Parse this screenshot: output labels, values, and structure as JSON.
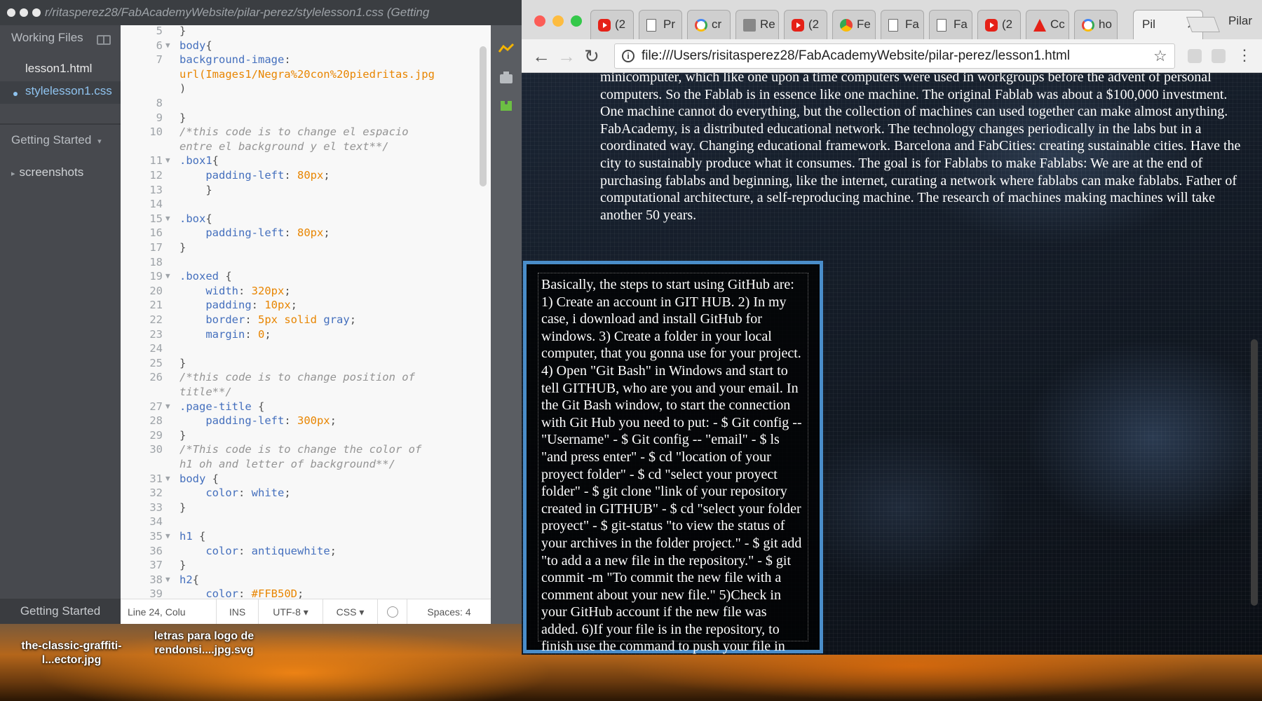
{
  "editor": {
    "title": "r/ritasperez28/FabAcademyWebsite/pilar-perez/stylelesson1.css (Getting",
    "sidebar": {
      "working_files_label": "Working Files",
      "files": [
        "lesson1.html",
        "stylelesson1.css"
      ],
      "project_label": "Getting Started",
      "project_folder": "screenshots",
      "bottom_tab": "Getting Started"
    },
    "code_lines": [
      {
        "n": "5",
        "fold": "",
        "html": "<span class='s-pun'>}</span>"
      },
      {
        "n": "6",
        "fold": "▼",
        "html": "<span class='s-sel'>body</span><span class='s-pun'>{</span>"
      },
      {
        "n": "7",
        "fold": "",
        "html": "<span class='s-prop'>background-image</span><span class='s-pun'>:</span>"
      },
      {
        "n": "",
        "fold": "",
        "html": "<span class='s-val'>url(Images1/Negra%20con%20piedritas.jpg</span>"
      },
      {
        "n": "",
        "fold": "",
        "html": "<span class='s-pun'>)</span>"
      },
      {
        "n": "8",
        "fold": "",
        "html": ""
      },
      {
        "n": "9",
        "fold": "",
        "html": "<span class='s-pun'>}</span>"
      },
      {
        "n": "10",
        "fold": "",
        "html": "<span class='s-com'>/*this code is to change el espacio</span>"
      },
      {
        "n": "",
        "fold": "",
        "html": "<span class='s-com'>entre el background y el text**/</span>"
      },
      {
        "n": "11",
        "fold": "▼",
        "html": "<span class='s-sel'>.box1</span><span class='s-pun'>{</span>"
      },
      {
        "n": "12",
        "fold": "",
        "html": "    <span class='s-prop'>padding-left</span><span class='s-pun'>: </span><span class='s-num'>80px</span><span class='s-pun'>;</span>"
      },
      {
        "n": "13",
        "fold": "",
        "html": "    <span class='s-pun'>}</span>"
      },
      {
        "n": "14",
        "fold": "",
        "html": ""
      },
      {
        "n": "15",
        "fold": "▼",
        "html": "<span class='s-sel'>.box</span><span class='s-pun'>{</span>"
      },
      {
        "n": "16",
        "fold": "",
        "html": "    <span class='s-prop'>padding-left</span><span class='s-pun'>: </span><span class='s-num'>80px</span><span class='s-pun'>;</span>"
      },
      {
        "n": "17",
        "fold": "",
        "html": "<span class='s-pun'>}</span>"
      },
      {
        "n": "18",
        "fold": "",
        "html": ""
      },
      {
        "n": "19",
        "fold": "▼",
        "html": "<span class='s-sel'>.boxed</span> <span class='s-pun'>{</span>"
      },
      {
        "n": "20",
        "fold": "",
        "html": "    <span class='s-prop'>width</span><span class='s-pun'>: </span><span class='s-num'>320px</span><span class='s-pun'>;</span>"
      },
      {
        "n": "21",
        "fold": "",
        "html": "    <span class='s-prop'>padding</span><span class='s-pun'>: </span><span class='s-num'>10px</span><span class='s-pun'>;</span>"
      },
      {
        "n": "22",
        "fold": "",
        "html": "    <span class='s-prop'>border</span><span class='s-pun'>: </span><span class='s-num'>5px</span> <span class='s-val'>solid</span> <span class='s-kw'>gray</span><span class='s-pun'>;</span>"
      },
      {
        "n": "23",
        "fold": "",
        "html": "    <span class='s-prop'>margin</span><span class='s-pun'>: </span><span class='s-num'>0</span><span class='s-pun'>;</span>"
      },
      {
        "n": "24",
        "fold": "",
        "html": ""
      },
      {
        "n": "25",
        "fold": "",
        "html": "<span class='s-pun'>}</span>"
      },
      {
        "n": "26",
        "fold": "",
        "html": "<span class='s-com'>/*this code is to change position of</span>"
      },
      {
        "n": "",
        "fold": "",
        "html": "<span class='s-com'>title**/</span>"
      },
      {
        "n": "27",
        "fold": "▼",
        "html": "<span class='s-sel'>.page-title</span> <span class='s-pun'>{</span>"
      },
      {
        "n": "28",
        "fold": "",
        "html": "    <span class='s-prop'>padding-left</span><span class='s-pun'>: </span><span class='s-num'>300px</span><span class='s-pun'>;</span>"
      },
      {
        "n": "29",
        "fold": "",
        "html": "<span class='s-pun'>}</span>"
      },
      {
        "n": "30",
        "fold": "",
        "html": "<span class='s-com'>/*This code is to change the color of</span>"
      },
      {
        "n": "",
        "fold": "",
        "html": "<span class='s-com'>h1 oh and letter of background**/</span>"
      },
      {
        "n": "31",
        "fold": "▼",
        "html": "<span class='s-sel'>body</span> <span class='s-pun'>{</span>"
      },
      {
        "n": "32",
        "fold": "",
        "html": "    <span class='s-prop'>color</span><span class='s-pun'>: </span><span class='s-kw'>white</span><span class='s-pun'>;</span>"
      },
      {
        "n": "33",
        "fold": "",
        "html": "<span class='s-pun'>}</span>"
      },
      {
        "n": "34",
        "fold": "",
        "html": ""
      },
      {
        "n": "35",
        "fold": "▼",
        "html": "<span class='s-sel'>h1</span> <span class='s-pun'>{</span>"
      },
      {
        "n": "36",
        "fold": "",
        "html": "    <span class='s-prop'>color</span><span class='s-pun'>: </span><span class='s-kw'>antiquewhite</span><span class='s-pun'>;</span>"
      },
      {
        "n": "37",
        "fold": "",
        "html": "<span class='s-pun'>}</span>"
      },
      {
        "n": "38",
        "fold": "▼",
        "html": "<span class='s-sel'>h2</span><span class='s-pun'>{</span>"
      },
      {
        "n": "39",
        "fold": "",
        "html": "    <span class='s-prop'>color</span><span class='s-pun'>: </span><span class='s-val'>#FFB50D</span><span class='s-pun'>;</span>"
      }
    ],
    "status": {
      "cursor": "Line 24, Colu",
      "mode": "INS",
      "encoding": "UTF-8 ▾",
      "language": "CSS ▾",
      "spaces": "Spaces: 4"
    }
  },
  "browser": {
    "tabs": [
      {
        "icon": "yt",
        "label": "(2"
      },
      {
        "icon": "doc",
        "label": "Pr"
      },
      {
        "icon": "goog",
        "label": "cr"
      },
      {
        "icon": "rec",
        "label": "Re"
      },
      {
        "icon": "yt",
        "label": "(2"
      },
      {
        "icon": "chr",
        "label": "Fe"
      },
      {
        "icon": "doc",
        "label": "Fa"
      },
      {
        "icon": "doc",
        "label": "Fa"
      },
      {
        "icon": "yt",
        "label": "(2"
      },
      {
        "icon": "adobe",
        "label": "Cc"
      },
      {
        "icon": "goog",
        "label": "ho"
      }
    ],
    "active_tab": "Pil",
    "profile": "Pilar",
    "url": "file:///Users/risitasperez28/FabAcademyWebsite/pilar-perez/lesson1.html",
    "page_paragraph": "minicomputer, which like one upon a time computers were used in workgroups before the advent of personal computers. So the Fablab is in essence like one machine. The original Fablab was about a $100,000 investment. One machine cannot do everything, but the collection of machines can used together can make almost anything. FabAcademy, is a distributed educational network. The technology changes periodically in the labs but in a coordinated way. Changing educational framework. Barcelona and FabCities: creating sustainable cities. Have the city to sustainably produce what it consumes. The goal is for Fablabs to make Fablabs: We are at the end of purchasing fablabs and beginning, like the internet, curating a network where fablabs can make fablabs. Father of computational architecture, a self-reproducing machine. The research of machines making machines will take another 50 years.",
    "boxed_text": "Basically, the steps to start using GitHub are: 1) Create an account in GIT HUB. 2) In my case, i download and install GitHub for windows. 3) Create a folder in your local computer, that you gonna use for your project. 4) Open \"Git Bash\" in Windows and start to tell GITHUB, who are you and your email. In the Git Bash window, to start the connection with Git Hub you need to put: - $ Git config -- \"Username\" - $ Git config -- \"email\" - $ ls \"and press enter\" - $ cd \"location of your proyect folder\" - $ cd \"select your proyect folder\" - $ git clone \"link of your repository created in GITHUB\" - $ cd \"select your folder proyect\" - $ git-status \"to view the status of your archives in the folder project.\" - $ git add \"to add a a new file in the repository.\" - $ git commit -m \"To commit the new file with a comment about your new file.\" 5)Check in your GitHub account if the new file was added. 6)If your file is in the repository, to finish use the command to push your file in the repository: - $ git push."
  },
  "desktop": {
    "files": [
      "the-classic-graffiti-l...ector.jpg",
      "letras para logo de rendonsi....jpg.svg"
    ]
  },
  "colors": {
    "accent_blue": "#4a8dc9",
    "css_selector": "#446fbd",
    "css_value": "#e88501",
    "comment": "#949494"
  }
}
